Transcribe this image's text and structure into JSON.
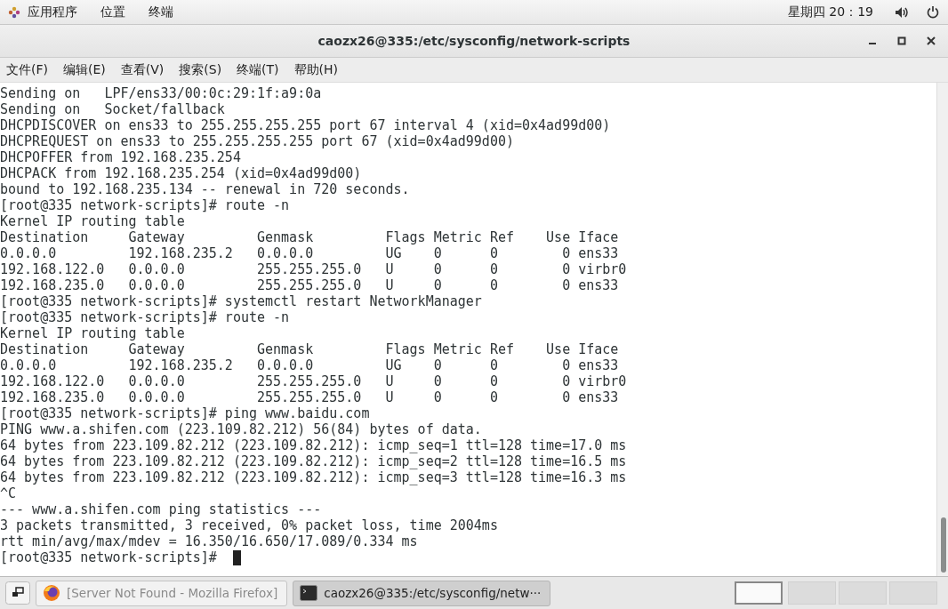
{
  "top_bar": {
    "menus": [
      "应用程序",
      "位置",
      "终端"
    ],
    "clock": "星期四 20：19"
  },
  "window": {
    "title": "caozx26@335:/etc/sysconfig/network-scripts"
  },
  "menu_bar": [
    "文件(F)",
    "编辑(E)",
    "查看(V)",
    "搜索(S)",
    "终端(T)",
    "帮助(H)"
  ],
  "terminal": {
    "lines": [
      "Sending on   LPF/ens33/00:0c:29:1f:a9:0a",
      "Sending on   Socket/fallback",
      "DHCPDISCOVER on ens33 to 255.255.255.255 port 67 interval 4 (xid=0x4ad99d00)",
      "DHCPREQUEST on ens33 to 255.255.255.255 port 67 (xid=0x4ad99d00)",
      "DHCPOFFER from 192.168.235.254",
      "DHCPACK from 192.168.235.254 (xid=0x4ad99d00)",
      "bound to 192.168.235.134 -- renewal in 720 seconds.",
      "[root@335 network-scripts]# route -n",
      "Kernel IP routing table",
      "Destination     Gateway         Genmask         Flags Metric Ref    Use Iface",
      "0.0.0.0         192.168.235.2   0.0.0.0         UG    0      0        0 ens33",
      "192.168.122.0   0.0.0.0         255.255.255.0   U     0      0        0 virbr0",
      "192.168.235.0   0.0.0.0         255.255.255.0   U     0      0        0 ens33",
      "[root@335 network-scripts]# systemctl restart NetworkManager",
      "[root@335 network-scripts]# route -n",
      "Kernel IP routing table",
      "Destination     Gateway         Genmask         Flags Metric Ref    Use Iface",
      "0.0.0.0         192.168.235.2   0.0.0.0         UG    0      0        0 ens33",
      "192.168.122.0   0.0.0.0         255.255.255.0   U     0      0        0 virbr0",
      "192.168.235.0   0.0.0.0         255.255.255.0   U     0      0        0 ens33",
      "[root@335 network-scripts]# ping www.baidu.com",
      "PING www.a.shifen.com (223.109.82.212) 56(84) bytes of data.",
      "64 bytes from 223.109.82.212 (223.109.82.212): icmp_seq=1 ttl=128 time=17.0 ms",
      "64 bytes from 223.109.82.212 (223.109.82.212): icmp_seq=2 ttl=128 time=16.5 ms",
      "64 bytes from 223.109.82.212 (223.109.82.212): icmp_seq=3 ttl=128 time=16.3 ms",
      "^C",
      "--- www.a.shifen.com ping statistics ---",
      "3 packets transmitted, 3 received, 0% packet loss, time 2004ms",
      "rtt min/avg/max/mdev = 16.350/16.650/17.089/0.334 ms"
    ],
    "prompt": "[root@335 network-scripts]#"
  },
  "taskbar": {
    "windows": [
      {
        "kind": "browser",
        "label": "[Server Not Found - Mozilla Firefox]",
        "selected": false
      },
      {
        "kind": "terminal",
        "label": "caozx26@335:/etc/sysconfig/netw···",
        "selected": true
      }
    ],
    "workspaces": [
      {
        "selected": true
      },
      {
        "selected": false
      },
      {
        "selected": false
      },
      {
        "selected": false
      }
    ]
  }
}
